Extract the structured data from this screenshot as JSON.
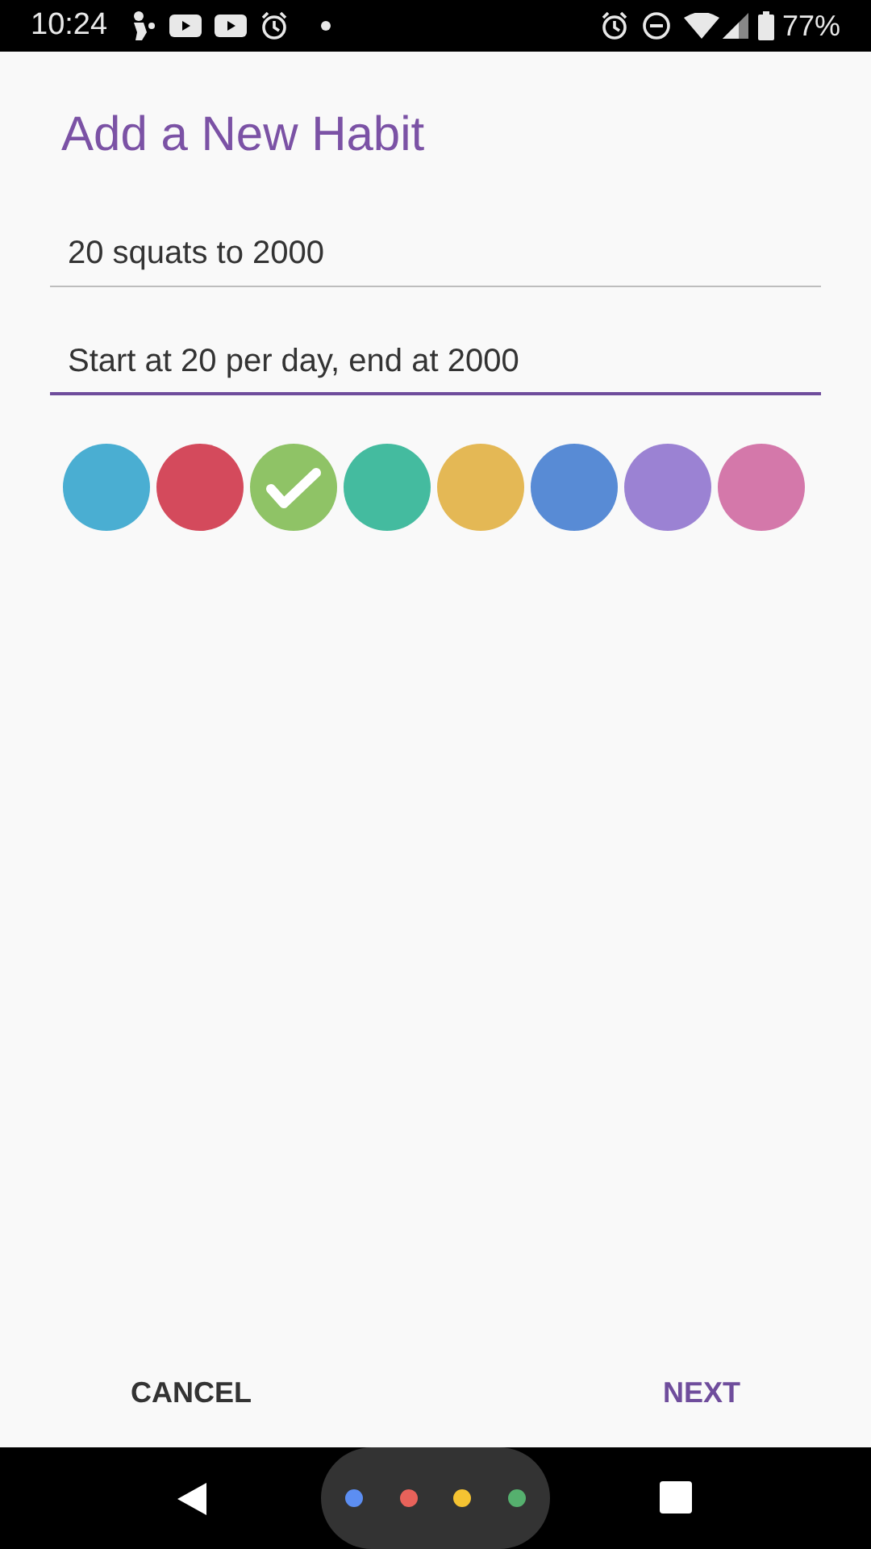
{
  "status_bar": {
    "time": "10:24",
    "battery": "77%"
  },
  "title": "Add a New Habit",
  "fields": [
    {
      "value": "20 squats to 2000",
      "focused": false
    },
    {
      "value": "Start at 20 per day, end at 2000",
      "focused": true
    }
  ],
  "colors": [
    {
      "color": "#4aaed2",
      "selected": false
    },
    {
      "color": "#d44a5c",
      "selected": false
    },
    {
      "color": "#8fc366",
      "selected": true
    },
    {
      "color": "#44bb9f",
      "selected": false
    },
    {
      "color": "#e4b855",
      "selected": false
    },
    {
      "color": "#588bd5",
      "selected": false
    },
    {
      "color": "#9b82d3",
      "selected": false
    },
    {
      "color": "#d478aa",
      "selected": false
    }
  ],
  "buttons": [
    {
      "label": "CANCEL",
      "kind": "secondary"
    },
    {
      "label": "NEXT",
      "kind": "primary"
    }
  ]
}
